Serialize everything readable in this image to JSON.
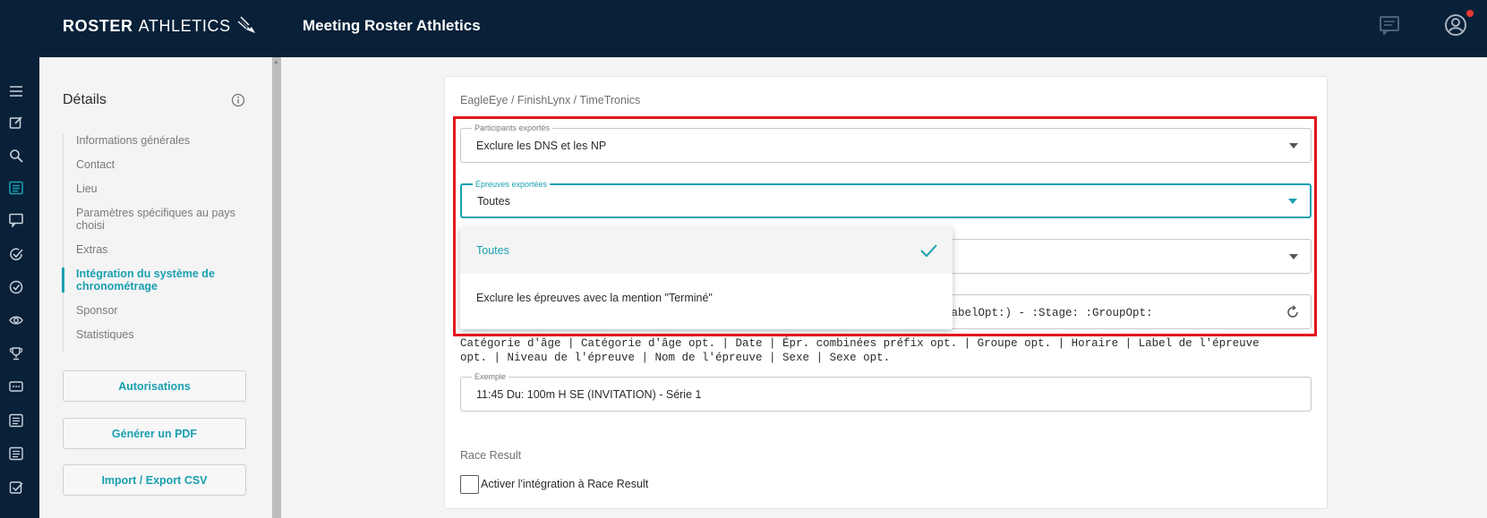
{
  "header": {
    "brand_bold": "ROSTER",
    "brand_thin": "ATHLETICS",
    "title": "Meeting Roster Athletics",
    "icons": [
      "chat-icon",
      "account-icon"
    ]
  },
  "rail": {
    "icons": [
      "menu-icon",
      "edit-icon",
      "search-icon",
      "list-icon",
      "chat-icon",
      "check-circle-icon",
      "check-circle-icon",
      "eye-icon",
      "trophy-icon",
      "timer-badge-icon",
      "list-icon",
      "list-icon",
      "checkbox-icon"
    ]
  },
  "sidebar": {
    "title": "Détails",
    "items": [
      {
        "label": "Informations générales"
      },
      {
        "label": "Contact"
      },
      {
        "label": "Lieu"
      },
      {
        "label": "Paramètres spécifiques au pays choisi"
      },
      {
        "label": "Extras"
      },
      {
        "label": "Intégration du système de chronométrage"
      },
      {
        "label": "Sponsor"
      },
      {
        "label": "Statistiques"
      }
    ],
    "buttons": {
      "authorizations": "Autorisations",
      "pdf": "Générer un PDF",
      "csv": "Import / Export CSV"
    }
  },
  "main": {
    "section_title": "EagleEye / FinishLynx / TimeTronics",
    "participants": {
      "legend": "Participants exportés",
      "value": "Exclure les DNS et les NP"
    },
    "events": {
      "legend": "Épreuves exportées",
      "value": "Toutes"
    },
    "pattern_value": "LabelOpt:) - :Stage: :GroupOpt:",
    "tokens_line1": "Catégorie d'âge | Catégorie d'âge opt. | Date | Épr. combinées préfix opt. | Groupe opt. | Horaire | Label de l'épreuve",
    "tokens_line2": "opt. | Niveau de l'épreuve | Nom de l'épreuve | Sexe | Sexe opt.",
    "example": {
      "legend": "Exemple",
      "value": "11:45 Du: 100m H SE (INVITATION) - Série 1"
    },
    "race_result": {
      "title": "Race Result",
      "checkbox_label": "Activer l'intégration à Race Result"
    }
  },
  "dropdown": {
    "options": [
      {
        "label": "Toutes",
        "selected": true
      },
      {
        "label": "Exclure les épreuves avec la mention \"Terminé\"",
        "selected": false
      }
    ]
  },
  "colors": {
    "navy": "#082038",
    "accent": "#1a9fb0",
    "highlight": "#e0161b",
    "notification": "#e53935"
  }
}
